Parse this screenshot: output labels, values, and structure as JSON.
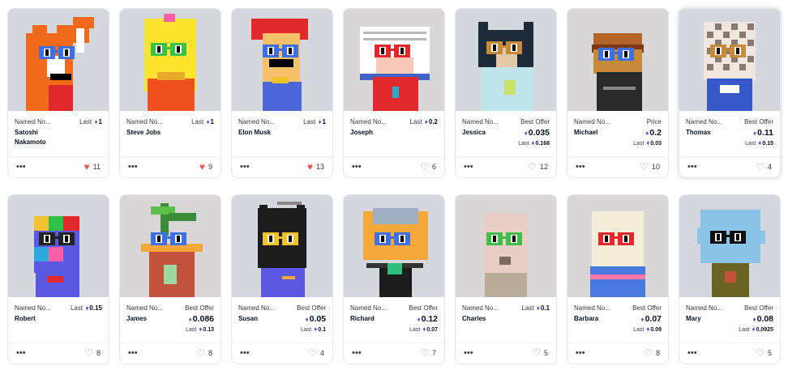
{
  "cards": [
    {
      "collection": "Named No...",
      "name": "Satoshi Nakamoto",
      "price_label": "Last",
      "price": "1",
      "favorites": "11",
      "liked": true,
      "bg": "#d5d7de",
      "variant": "fox",
      "accent": "#f26a1b"
    },
    {
      "collection": "Named No...",
      "name": "Steve Jobs",
      "price_label": "Last",
      "price": "1",
      "favorites": "9",
      "liked": true,
      "bg": "#d5d7de",
      "variant": "yellow",
      "accent": "#fde52f"
    },
    {
      "collection": "Named No...",
      "name": "Elon Musk",
      "price_label": "Last",
      "price": "1",
      "favorites": "13",
      "liked": true,
      "bg": "#d5d7de",
      "variant": "redhair",
      "accent": "#e0282d"
    },
    {
      "collection": "Named No...",
      "name": "Joseph",
      "price_label": "Last",
      "price": "0.2",
      "favorites": "6",
      "liked": false,
      "bg": "#d9d6d8",
      "variant": "book",
      "accent": "#3f63c8"
    },
    {
      "collection": "Named No...",
      "name": "Jessica",
      "offer_label": "Best Offer",
      "offer": "0.035",
      "last_label": "Last",
      "last": "0.168",
      "favorites": "12",
      "liked": false,
      "bg": "#d5d7de",
      "variant": "cat",
      "accent": "#bfe4ea"
    },
    {
      "collection": "Named No...",
      "name": "Michael",
      "offer_label": "Price",
      "offer": "0.2",
      "last_label": "Last",
      "last": "0.03",
      "favorites": "10",
      "liked": false,
      "bg": "#d9d6d8",
      "variant": "burger",
      "accent": "#9a5a2a"
    },
    {
      "collection": "Named No...",
      "name": "Thomas",
      "offer_label": "Best Offer",
      "offer": "0.11",
      "last_label": "Last",
      "last": "0.15",
      "favorites": "4",
      "liked": false,
      "bg": "#d5d7de",
      "variant": "grid",
      "accent": "#3858c8",
      "highlight": true
    },
    {
      "collection": "Named No...",
      "name": "Robert",
      "price_label": "Last",
      "price": "0.15",
      "favorites": "8",
      "liked": false,
      "bg": "#d5d7de",
      "variant": "rubik",
      "accent": "#5a57e0"
    },
    {
      "collection": "Named No...",
      "name": "James",
      "offer_label": "Best Offer",
      "offer": "0.086",
      "last_label": "Last",
      "last": "0.13",
      "favorites": "8",
      "liked": false,
      "bg": "#d9d6d8",
      "variant": "plant",
      "accent": "#c2523b"
    },
    {
      "collection": "Named No...",
      "name": "Susan",
      "offer_label": "Best Offer",
      "offer": "0.05",
      "last_label": "Last",
      "last": "0.1",
      "favorites": "4",
      "liked": false,
      "bg": "#d5d7de",
      "variant": "blackcat",
      "accent": "#5a57e0"
    },
    {
      "collection": "Named No...",
      "name": "Richard",
      "offer_label": "Best Offer",
      "offer": "0.12",
      "last_label": "Last",
      "last": "0.07",
      "favorites": "7",
      "liked": false,
      "bg": "#d5d7de",
      "variant": "cup",
      "accent": "#f5a83a"
    },
    {
      "collection": "Named No...",
      "name": "Charles",
      "price_label": "Last",
      "price": "0.1",
      "favorites": "5",
      "liked": false,
      "bg": "#d9d6d8",
      "variant": "pale",
      "accent": "#e7cfc8"
    },
    {
      "collection": "Named No...",
      "name": "Barbara",
      "offer_label": "Best Offer",
      "offer": "0.07",
      "last_label": "Last",
      "last": "0.09",
      "favorites": "8",
      "liked": false,
      "bg": "#d9d6d8",
      "variant": "cream",
      "accent": "#f3ecd8"
    },
    {
      "collection": "Named No...",
      "name": "Mary",
      "offer_label": "Best Offer",
      "offer": "0.08",
      "last_label": "Last",
      "last": "0.0925",
      "favorites": "5",
      "liked": false,
      "bg": "#d5d7de",
      "variant": "blob",
      "accent": "#8cc4e8"
    }
  ],
  "icons": {
    "more": "more-dots-icon",
    "favorite": "heart-icon",
    "currency": "ethereum-icon"
  }
}
